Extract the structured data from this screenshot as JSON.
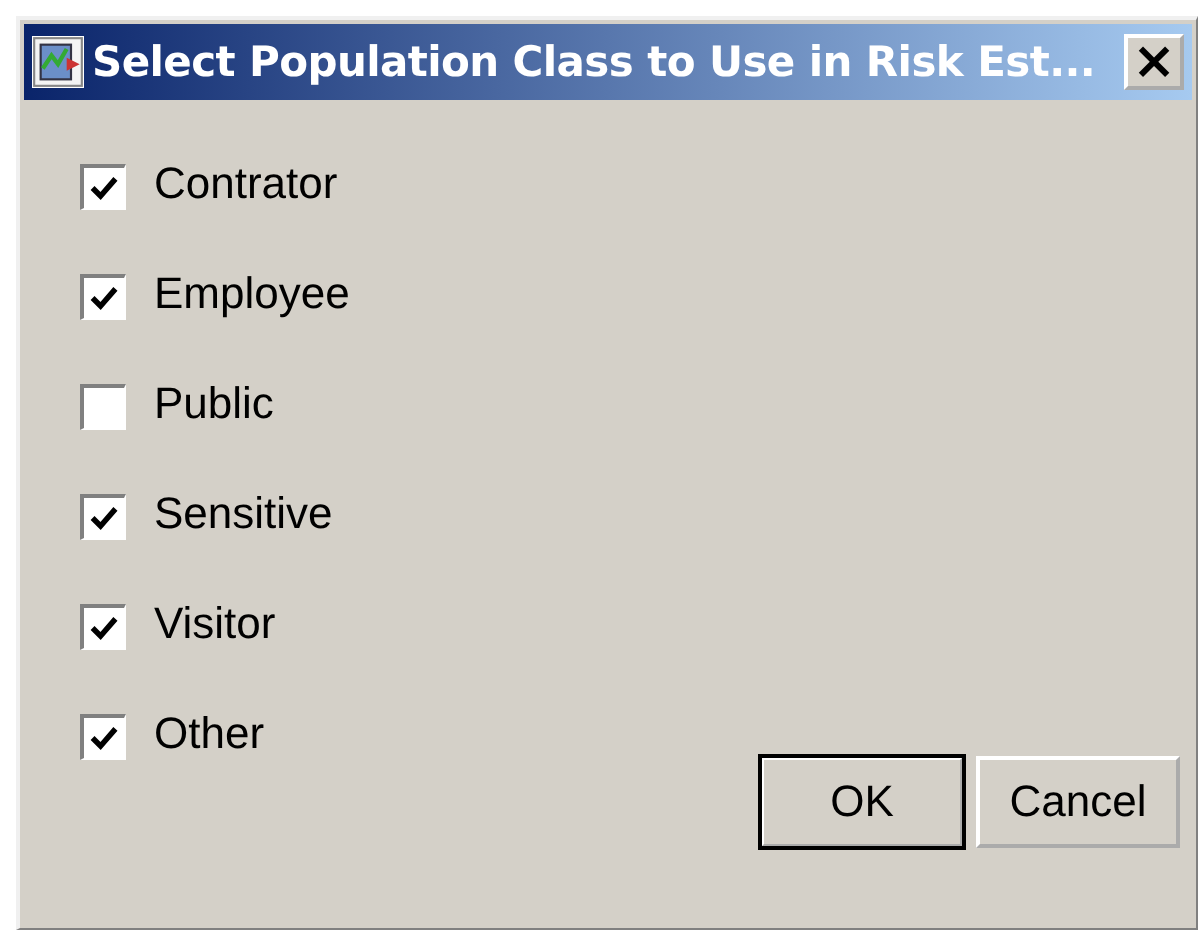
{
  "window": {
    "title": "Select Population Class to Use in Risk Est...",
    "close": "×"
  },
  "options": [
    {
      "label": "Contrator",
      "checked": true
    },
    {
      "label": "Employee",
      "checked": true
    },
    {
      "label": "Public",
      "checked": false
    },
    {
      "label": "Sensitive",
      "checked": true
    },
    {
      "label": "Visitor",
      "checked": true
    },
    {
      "label": "Other",
      "checked": true
    }
  ],
  "buttons": [
    {
      "label": "OK",
      "default": true
    },
    {
      "label": "Cancel",
      "default": false
    }
  ]
}
